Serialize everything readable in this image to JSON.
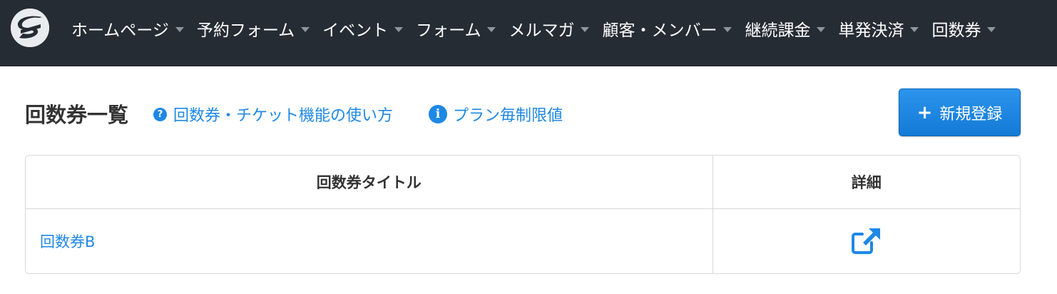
{
  "nav": {
    "items": [
      {
        "label": "ホームページ"
      },
      {
        "label": "予約フォーム"
      },
      {
        "label": "イベント"
      },
      {
        "label": "フォーム"
      },
      {
        "label": "メルマガ"
      },
      {
        "label": "顧客・メンバー"
      },
      {
        "label": "継続課金"
      },
      {
        "label": "単発決済"
      },
      {
        "label": "回数券"
      }
    ]
  },
  "header": {
    "title": "回数券一覧",
    "help_link": "回数券・チケット機能の使い方",
    "plan_link": "プラン毎制限値",
    "new_button": "新規登録"
  },
  "table": {
    "columns": [
      "回数券タイトル",
      "詳細"
    ],
    "rows": [
      {
        "title": "回数券B"
      }
    ]
  },
  "colors": {
    "navbar_bg": "#262c33",
    "link": "#1e88e5",
    "button": "#1e88e5"
  }
}
